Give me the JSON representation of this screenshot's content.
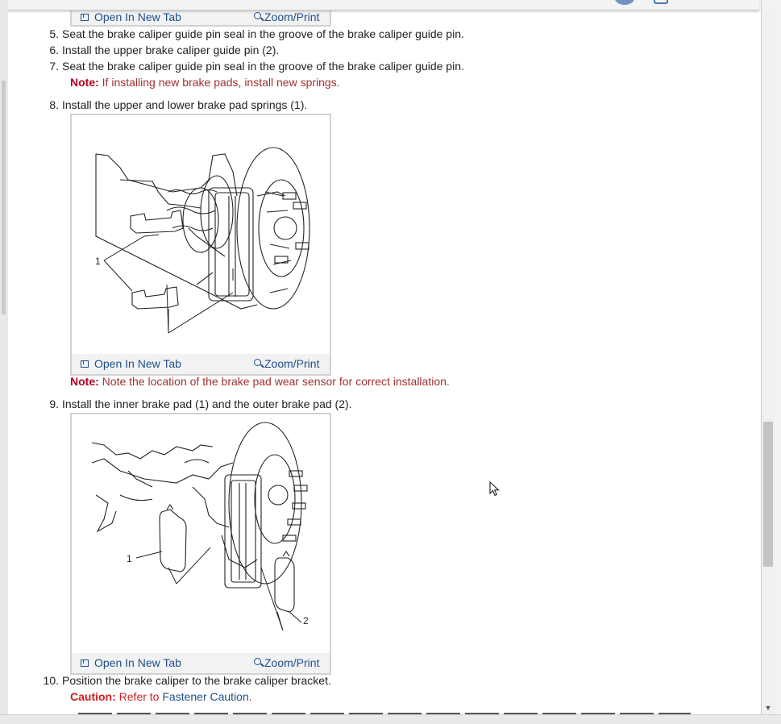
{
  "figure_links": {
    "open": "Open In New Tab",
    "zoom": "Zoom/Print"
  },
  "steps": [
    {
      "num": "5.",
      "text": "Seat the brake caliper guide pin seal in the groove of the brake caliper guide pin."
    },
    {
      "num": "6.",
      "text": "Install the upper brake caliper guide pin (2)."
    },
    {
      "num": "7.",
      "text": "Seat the brake caliper guide pin seal in the groove of the brake caliper guide pin."
    },
    {
      "num": "8.",
      "text": "Install the upper and lower brake pad springs (1)."
    },
    {
      "num": "9.",
      "text": "Install the inner brake pad (1) and the outer brake pad (2)."
    },
    {
      "num": "10.",
      "text": "Position the brake caliper to the brake caliper bracket."
    }
  ],
  "notes": [
    {
      "label": "Note:",
      "text": " If installing new brake pads, install new springs."
    },
    {
      "label": "Note:",
      "text": " Note the location of the brake pad wear sensor for correct installation."
    }
  ],
  "caution": {
    "label": "Caution:",
    "text": " Refer to ",
    "link": "Fastener Caution",
    "end": "."
  },
  "figure1": {
    "callouts": [
      "1"
    ]
  },
  "figure2": {
    "callouts": [
      "1",
      "2"
    ]
  },
  "colors": {
    "link": "#1d4f8c",
    "note": "#a03030",
    "caution": "#d01f1f",
    "scroll_thumb": "#c3c3c3"
  },
  "icons": [
    "open-in-new-tab-icon",
    "zoom-icon",
    "mouse-pointer-icon"
  ]
}
